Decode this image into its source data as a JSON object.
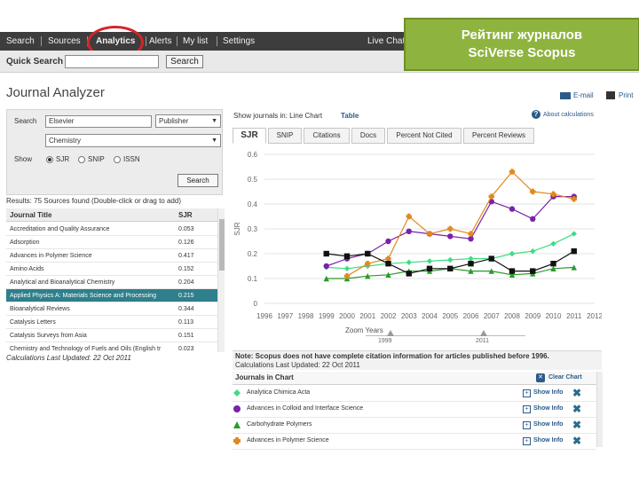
{
  "nav": {
    "items": [
      "Search",
      "Sources",
      "Analytics",
      "Alerts",
      "My list",
      "Settings"
    ],
    "live_chat": "Live Chat"
  },
  "quick_search": {
    "label": "Quick Search",
    "value": "",
    "button": "Search"
  },
  "callout": {
    "line1": "Рейтинг журналов",
    "line2": "SciVerse Scopus"
  },
  "page": {
    "title": "Journal Analyzer",
    "email": "E-mail",
    "print": "Print"
  },
  "search_panel": {
    "search_label": "Search",
    "search_value": "Elsevier",
    "publisher_option": "Publisher",
    "subject_option": "Chemistry",
    "show_label": "Show",
    "show_options": [
      "SJR",
      "SNIP",
      "ISSN"
    ],
    "selected_show": "SJR",
    "search_button": "Search"
  },
  "results": {
    "summary": "Results: 75 Sources found (Double-click or drag to add)",
    "col_title": "Journal Title",
    "col_metric": "SJR",
    "rows": [
      {
        "title": "Accreditation and Quality Assurance",
        "value": "0.053"
      },
      {
        "title": "Adsorption",
        "value": "0.126"
      },
      {
        "title": "Advances in Polymer Science",
        "value": "0.417"
      },
      {
        "title": "Amino Acids",
        "value": "0.152"
      },
      {
        "title": "Analytical and Bioanalytical Chemistry",
        "value": "0.204"
      },
      {
        "title": "Applied Physics A: Materials Science and Processing",
        "value": "0.215"
      },
      {
        "title": "Bioanalytical Reviews",
        "value": "0.344"
      },
      {
        "title": "Catalysis Letters",
        "value": "0.113"
      },
      {
        "title": "Catalysis Surveys from Asia",
        "value": "0.151"
      },
      {
        "title": "Chemistry and Technology of Fuels and Oils (English tr",
        "value": "0.023"
      }
    ],
    "selected_index": 5,
    "calc_updated": "Calculations Last Updated: 22 Oct 2011"
  },
  "chart_panel": {
    "show_label": "Show journals in: Line Chart",
    "table_link": "Table",
    "about_link": "About calculations",
    "tabs": [
      "SJR",
      "SNIP",
      "Citations",
      "Docs",
      "Percent Not Cited",
      "Percent Reviews"
    ],
    "active_tab": "SJR"
  },
  "chart_data": {
    "type": "line",
    "ylabel": "SJR",
    "xlabel": "",
    "x": [
      1996,
      1997,
      1998,
      1999,
      2000,
      2001,
      2002,
      2003,
      2004,
      2005,
      2006,
      2007,
      2008,
      2009,
      2010,
      2011,
      2012
    ],
    "ylim": [
      0,
      0.6
    ],
    "yticks": [
      "0",
      "0.1",
      "0.2",
      "0.3",
      "0.4",
      "0.5",
      "0.6"
    ],
    "series": [
      {
        "name": "Analytica Chimica Acta",
        "color": "#3ddc84",
        "marker": "diamond",
        "values": [
          null,
          null,
          null,
          0.145,
          0.14,
          0.15,
          0.16,
          0.165,
          0.17,
          0.175,
          0.18,
          0.18,
          0.2,
          0.21,
          0.24,
          0.28,
          null
        ]
      },
      {
        "name": "Advances in Colloid and Interface Science",
        "color": "#7b22a8",
        "marker": "circle",
        "values": [
          null,
          null,
          null,
          0.15,
          0.18,
          0.2,
          0.25,
          0.29,
          0.28,
          0.27,
          0.26,
          0.41,
          0.38,
          0.34,
          0.43,
          0.43,
          null
        ]
      },
      {
        "name": "Carbohydrate Polymers",
        "color": "#2a9a2a",
        "marker": "triangle",
        "values": [
          null,
          null,
          null,
          0.1,
          0.1,
          0.11,
          0.115,
          0.13,
          0.13,
          0.14,
          0.13,
          0.13,
          0.115,
          0.12,
          0.14,
          0.145,
          null
        ]
      },
      {
        "name": "Advances in Polymer Science",
        "color": "#e08a1e",
        "marker": "cross",
        "values": [
          null,
          null,
          null,
          null,
          0.11,
          0.16,
          0.18,
          0.35,
          0.28,
          0.3,
          0.28,
          0.43,
          0.53,
          0.45,
          0.44,
          0.42,
          null
        ]
      },
      {
        "name": "",
        "color": "#111111",
        "marker": "square",
        "values": [
          null,
          null,
          null,
          0.2,
          0.19,
          0.2,
          0.16,
          0.12,
          0.14,
          0.14,
          0.16,
          0.18,
          0.13,
          0.13,
          0.16,
          0.21,
          null
        ]
      }
    ]
  },
  "zoom": {
    "label": "Zoom Years",
    "start": "1999",
    "end": "2011"
  },
  "note": {
    "text": "Note: Scopus does not have complete citation information for articles published before 1996.",
    "calc": "Calculations Last Updated: 22 Oct 2011"
  },
  "journals_in_chart": {
    "title": "Journals in Chart",
    "clear_label": "Clear Chart",
    "show_info_label": "Show Info",
    "items": [
      {
        "name": "Analytica Chimica Acta",
        "color": "#3ddc84",
        "marker": "diamond"
      },
      {
        "name": "Advances in Colloid and Interface Science",
        "color": "#7b22a8",
        "marker": "circle"
      },
      {
        "name": "Carbohydrate Polymers",
        "color": "#2a9a2a",
        "marker": "triangle"
      },
      {
        "name": "Advances in Polymer Science",
        "color": "#e08a1e",
        "marker": "cross"
      }
    ]
  },
  "icons": {
    "email": "envelope-icon",
    "print": "printer-icon",
    "help": "question-icon",
    "clear": "clear-chart-icon",
    "info": "info-icon",
    "remove": "remove-x-icon"
  }
}
